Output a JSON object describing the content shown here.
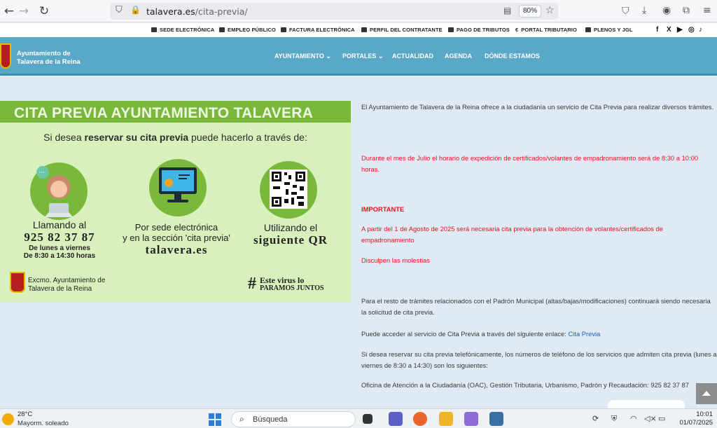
{
  "browser": {
    "url_host": "talavera.es",
    "url_path": "/cita-previa/",
    "zoom": "80%"
  },
  "topbar": {
    "items": [
      "SEDE ELECTRÓNICA",
      "EMPLEO PÚBLICO",
      "FACTURA ELECTRÓNICA",
      "PERFIL DEL CONTRATANTE",
      "PAGO DE TRIBUTOS",
      "PORTAL TRIBUTARIO",
      "PLENOS Y JGL"
    ],
    "social": [
      "f",
      "X",
      "▶",
      "◎",
      "♪"
    ]
  },
  "header": {
    "site_title_1": "Ayuntamiento de",
    "site_title_2": "Talavera de la Reina",
    "menu": [
      "AYUNTAMIENTO ⌄",
      "PORTALES ⌄",
      "ACTUALIDAD",
      "AGENDA",
      "DÓNDE ESTAMOS"
    ]
  },
  "banner": {
    "title": "CITA PREVIA AYUNTAMIENTO TALAVERA",
    "subtitle_pre": "Si desea ",
    "subtitle_bold": "reservar su cita previa",
    "subtitle_post": " puede hacerlo a través de:",
    "col1_line1": "Llamando al",
    "col1_phone": "925 82 37 87",
    "col1_days": "De lunes a viernes",
    "col1_hours": "De 8:30 a 14:30 horas",
    "col2_line1": "Por sede electrónica",
    "col2_line2": "y en la sección 'cita previa'",
    "col2_site": "talavera.es",
    "col3_line1": "Utilizando el",
    "col3_line2": "siguiente QR",
    "excmo_1": "Excmo. Ayuntamiento de",
    "excmo_2": "Talavera de la Reina",
    "virus_hash": "#",
    "virus_1": "Este virus lo",
    "virus_2": "PARAMOS JUNTOS"
  },
  "content": {
    "p1": "El Ayuntamiento de Talavera de la Reina ofrece a la ciudadanía un servicio de Cita Previa para realizar diversos trámites.",
    "p2": "Durante el mes de Julio el horario de expedición de certificados/volantes de empadronamiento será de 8:30 a 10:00 horas.",
    "important": "IMPORTANTE",
    "p3": "A partir del 1 de Agosto de 2025 será necesaria cita previa para la obtención de volantes/certificados de empadronamiento",
    "p4": "Disculpen las molestias",
    "p5": "Para el resto de trámites relacionados con el Padrón Municipal (altas/bajas/modificaciones) continuará siendo necesaria la solicitud de cita previa.",
    "p6_pre": "Puede acceder al servicio de Cita Previa a través del siguiente enlace: ",
    "p6_link": "Cita Previa",
    "p7": "Si desea reservar su cita previa telefónicamente, los números de teléfono de los servicios que admiten cita previa (lunes a viernes de 8:30 a 14:30) son los siguientes:",
    "p8": "Oficina de Atención a la Ciudadanía (OAC), Gestión Tributaria, Urbanismo, Padrón y Recaudación: 925 82 37 87"
  },
  "taskbar": {
    "temp": "28°C",
    "weather": "Mayorm. soleado",
    "search": "Búsqueda",
    "time": "10:01",
    "date": "01/07/2025"
  }
}
